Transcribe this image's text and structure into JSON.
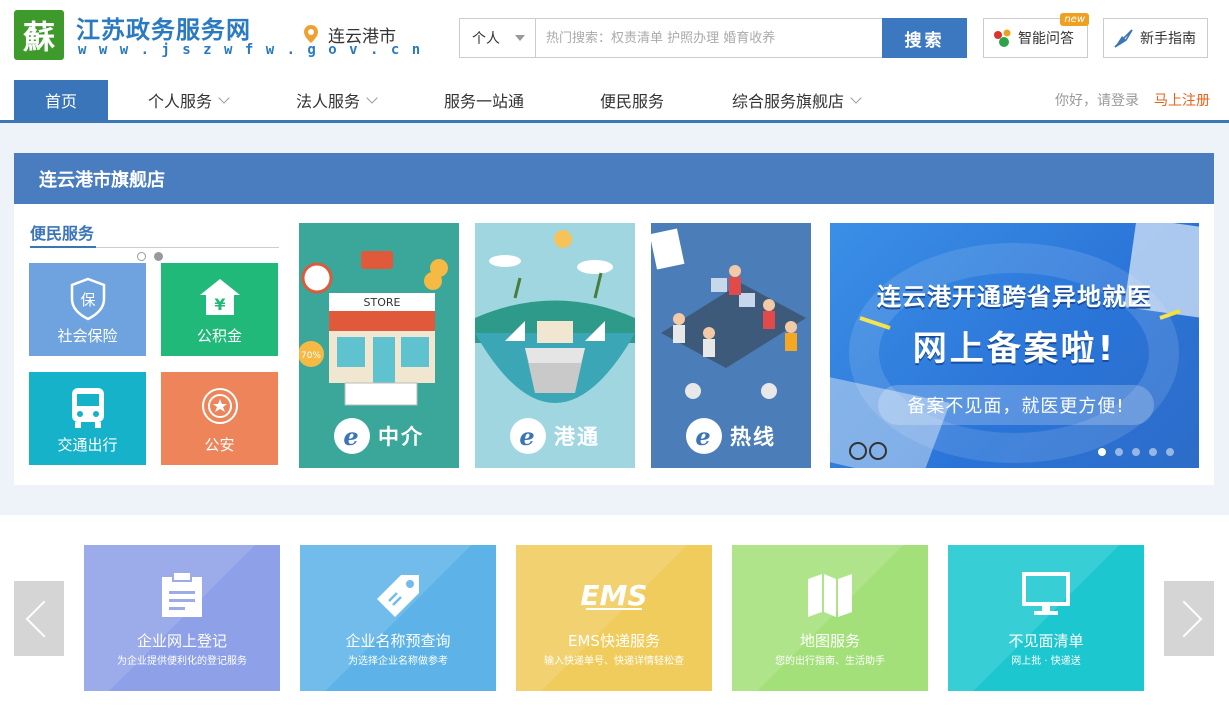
{
  "header": {
    "logo_char": "蘇",
    "site_title": "江苏政务服务网",
    "site_url": "w w w . j s z w f w . g o v . c n",
    "location": "连云港市",
    "search": {
      "type_selected": "个人",
      "placeholder": "热门搜索：权责清单 护照办理 婚育收养",
      "button_label": "搜索"
    },
    "ai_button_label": "智能问答",
    "ai_badge": "new",
    "guide_button_label": "新手指南"
  },
  "nav": {
    "items": [
      {
        "label": "首页",
        "active": true
      },
      {
        "label": "个人服务",
        "has_dropdown": true
      },
      {
        "label": "法人服务",
        "has_dropdown": true
      },
      {
        "label": "服务一站通"
      },
      {
        "label": "便民服务"
      },
      {
        "label": "综合服务旗舰店",
        "has_dropdown": true
      }
    ],
    "greeting": "你好，请登录",
    "register": "马上注册"
  },
  "store": {
    "title": "连云港市旗舰店",
    "convenience": {
      "title": "便民服务",
      "tiles": [
        {
          "label": "社会保险",
          "icon": "insurance-icon",
          "color": "#6fa3e0"
        },
        {
          "label": "公积金",
          "icon": "housing-fund-icon",
          "color": "#21b97a"
        },
        {
          "label": "交通出行",
          "icon": "bus-icon",
          "color": "#15b2c9"
        },
        {
          "label": "公安",
          "icon": "police-badge-icon",
          "color": "#ed845a"
        }
      ]
    },
    "promos": [
      {
        "label": "中介",
        "store_sign": "STORE",
        "discount": "70%"
      },
      {
        "label": "港通"
      },
      {
        "label": "热线"
      }
    ],
    "banner": {
      "line1": "连云港开通跨省异地就医",
      "line2": "网上备案啦!",
      "pill": "备案不见面，就医更方便!",
      "slide_count": 5,
      "active_slide": 1
    }
  },
  "features": [
    {
      "title": "企业网上登记",
      "subtitle": "为企业提供便利化的登记服务",
      "icon": "clipboard-icon",
      "color": "#8ea1e8"
    },
    {
      "title": "企业名称预查询",
      "subtitle": "为选择企业名称做参考",
      "icon": "tag-icon",
      "color": "#5db3e8"
    },
    {
      "title": "EMS快递服务",
      "subtitle": "输入快递单号、快递详情轻松查",
      "icon": "ems-logo-icon",
      "icon_text": "EMS",
      "color": "#f0cc5c"
    },
    {
      "title": "地图服务",
      "subtitle": "您的出行指南、生活助手",
      "icon": "map-icon",
      "color": "#a4e07a"
    },
    {
      "title": "不见面清单",
      "subtitle": "网上批 · 快递送",
      "icon": "monitor-icon",
      "color": "#1cc7cf"
    }
  ]
}
